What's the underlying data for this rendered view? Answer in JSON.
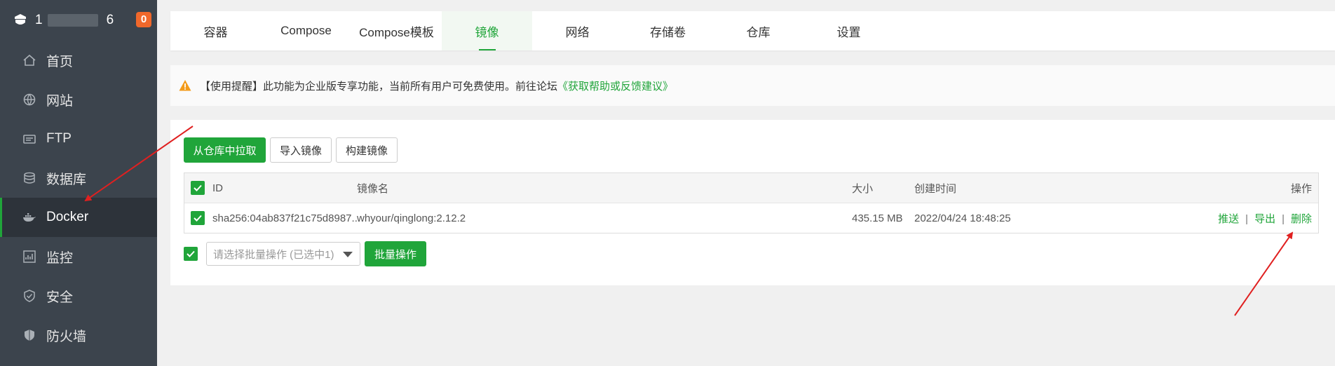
{
  "sidebar": {
    "ip_prefix": "1",
    "ip_suffix": "6",
    "badge": "0",
    "items": [
      {
        "label": "首页",
        "icon": "home-icon"
      },
      {
        "label": "网站",
        "icon": "globe-icon"
      },
      {
        "label": "FTP",
        "icon": "ftp-icon"
      },
      {
        "label": "数据库",
        "icon": "database-icon"
      },
      {
        "label": "Docker",
        "icon": "docker-icon",
        "active": true
      },
      {
        "label": "监控",
        "icon": "monitor-icon"
      },
      {
        "label": "安全",
        "icon": "shield-icon"
      },
      {
        "label": "防火墙",
        "icon": "firewall-icon"
      }
    ]
  },
  "tabs": [
    "容器",
    "Compose",
    "Compose模板",
    "镜像",
    "网络",
    "存储卷",
    "仓库",
    "设置"
  ],
  "active_tab": "镜像",
  "notice": {
    "text": "【使用提醒】此功能为企业版专享功能，当前所有用户可免费使用。前往论坛",
    "link": "《获取帮助或反馈建议》"
  },
  "toolbar": {
    "pull_label": "从仓库中拉取",
    "import_label": "导入镜像",
    "build_label": "构建镜像"
  },
  "table": {
    "headers": {
      "id": "ID",
      "name": "镜像名",
      "size": "大小",
      "created": "创建时间",
      "ops": "操作"
    },
    "rows": [
      {
        "id": "sha256:04ab837f21c75d8987...",
        "name": "whyour/qinglong:2.12.2",
        "size": "435.15 MB",
        "created": "2022/04/24 18:48:25",
        "ops": [
          "推送",
          "导出",
          "删除"
        ]
      }
    ]
  },
  "batch": {
    "placeholder": "请选择批量操作 (已选中1)",
    "button_label": "批量操作"
  },
  "colors": {
    "accent": "#20a53a",
    "sidebar_bg": "#3c444d",
    "badge": "#f0682b",
    "annotation_arrow": "#e02020"
  }
}
